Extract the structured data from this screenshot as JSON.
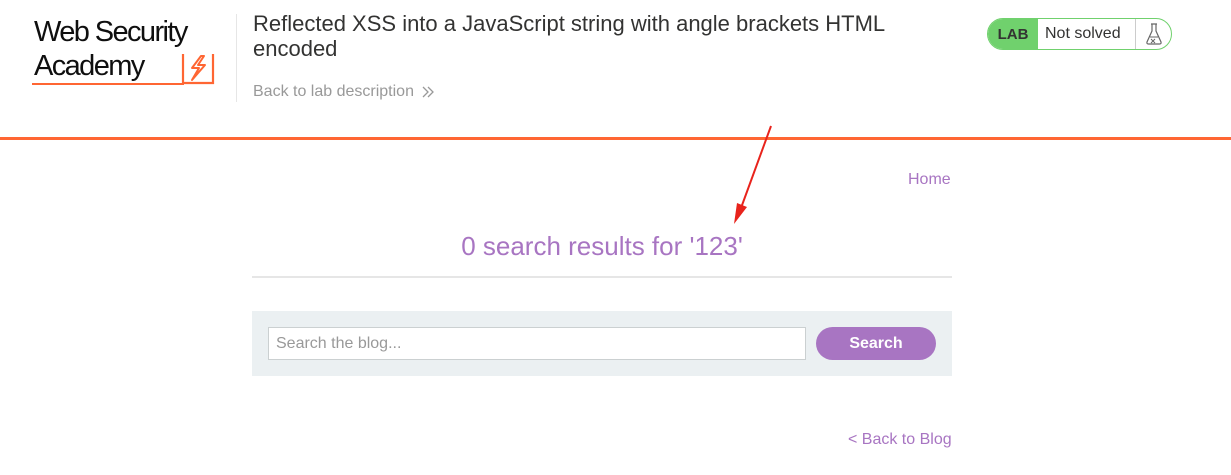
{
  "header": {
    "logo": {
      "line1": "Web Security",
      "line2": "Academy",
      "icon": "lightning-bolt-icon"
    },
    "lab_title": "Reflected XSS into a JavaScript string with angle brackets HTML encoded",
    "back_link": "Back to lab description",
    "back_link_icon": "double-chevron-right-icon",
    "lab_status": {
      "badge": "LAB",
      "state": "Not solved",
      "icon": "flask-icon"
    }
  },
  "nav": {
    "home": "Home"
  },
  "main": {
    "results_heading": "0 search results for '123'",
    "search": {
      "placeholder": "Search the blog...",
      "value": "",
      "button": "Search"
    },
    "back_to_blog": "< Back to Blog"
  },
  "colors": {
    "accent_orange": "#ff6633",
    "link_purple": "#a875c2",
    "lab_green": "#70d16d",
    "search_panel_bg": "#ebf0f2",
    "annotation_arrow": "#e8231c"
  }
}
